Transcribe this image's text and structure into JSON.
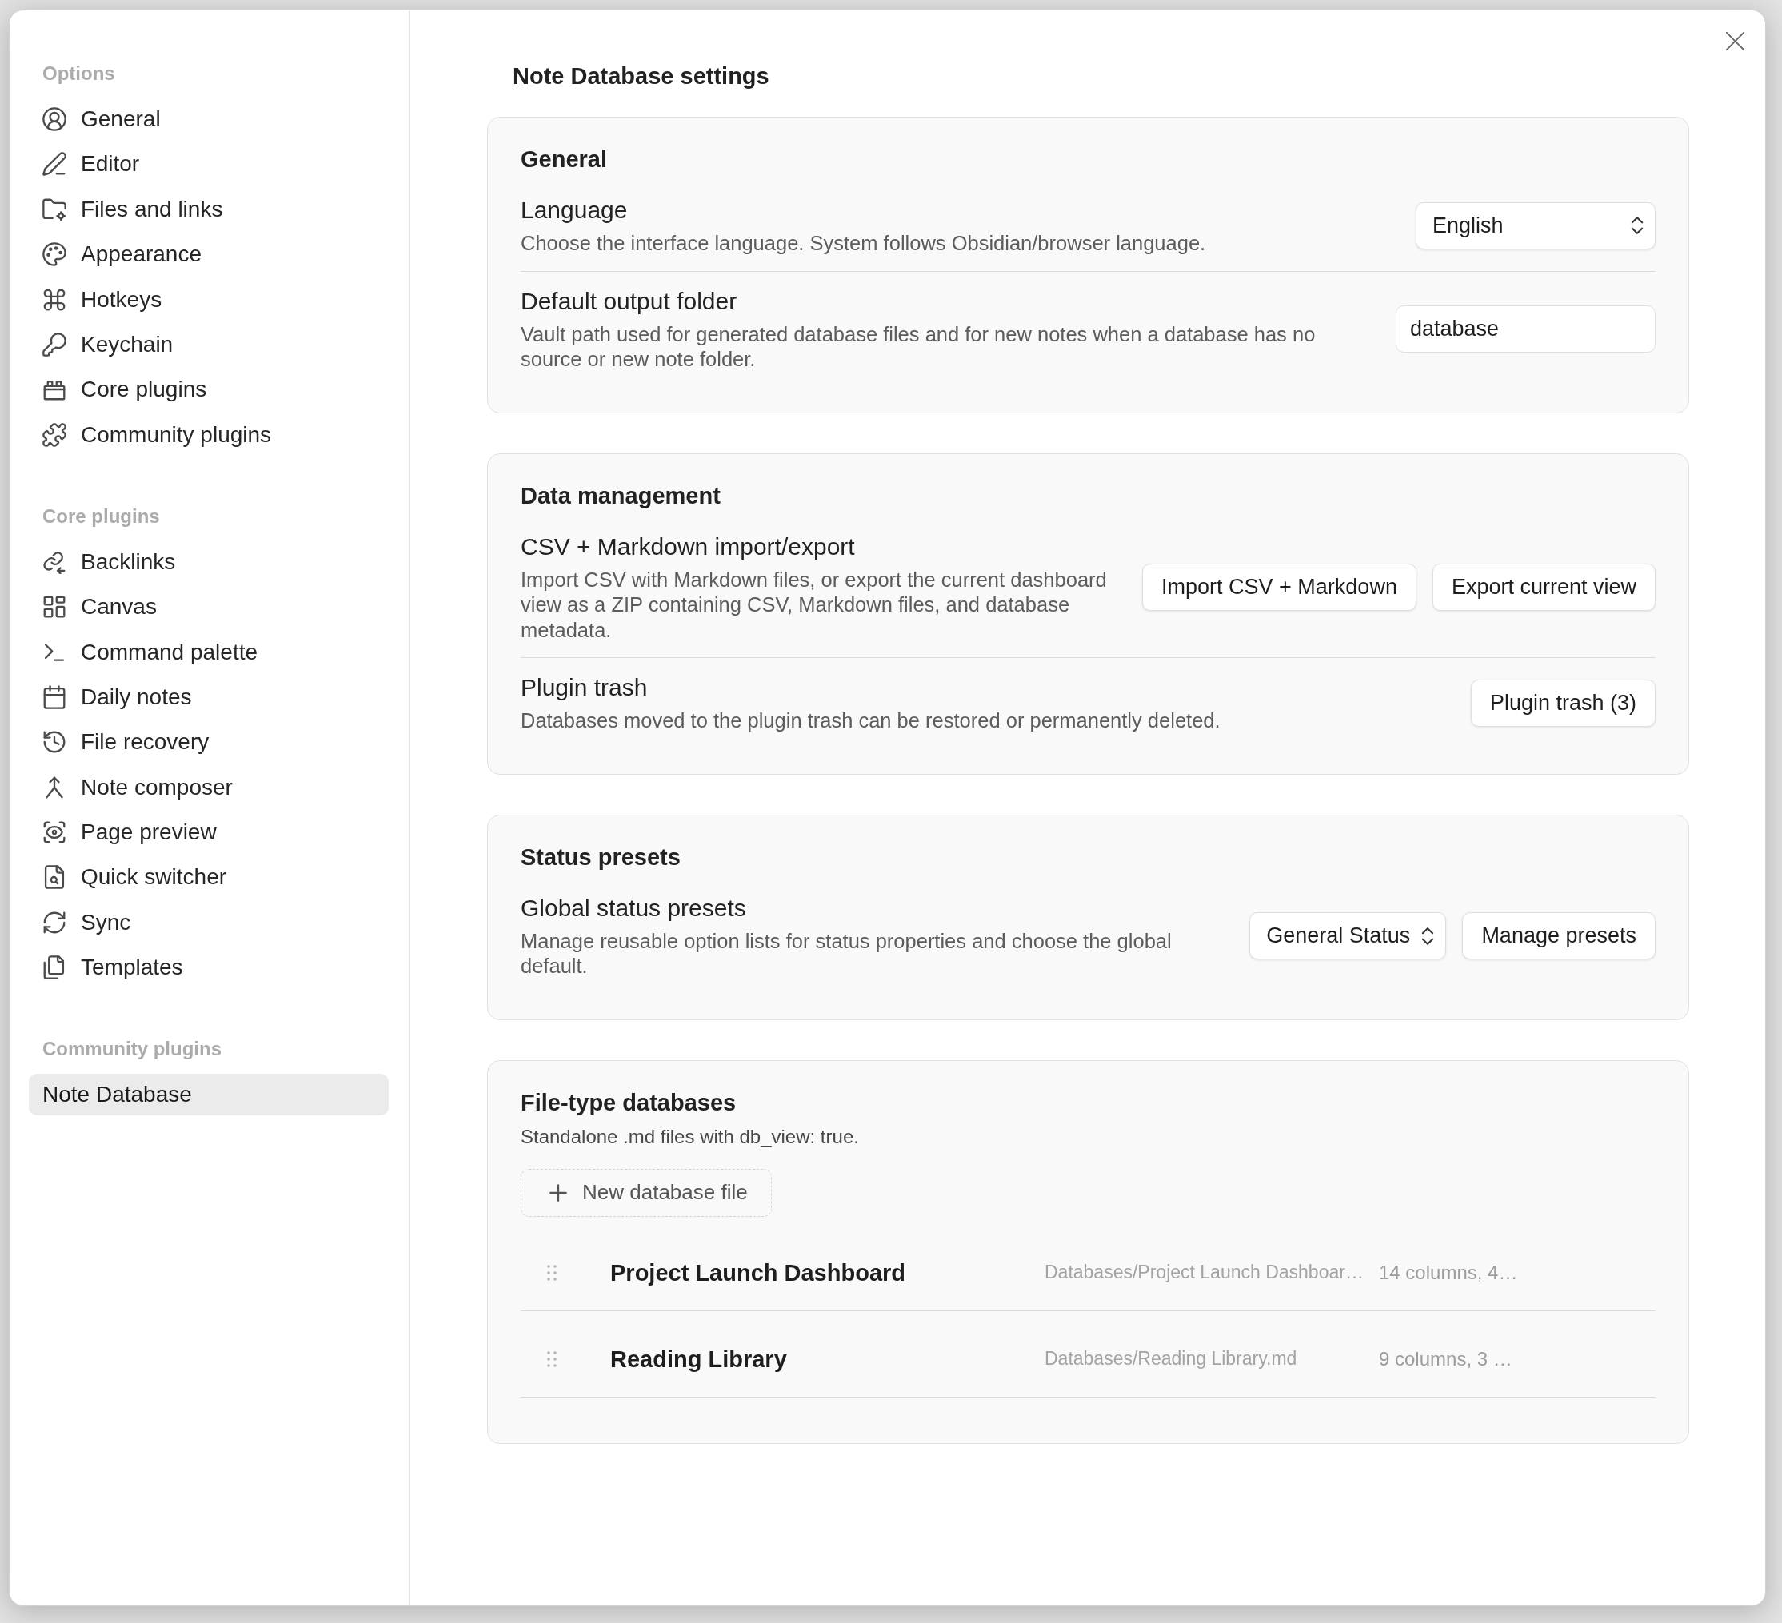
{
  "sidebar": {
    "sections": [
      {
        "heading": "Options",
        "items": [
          {
            "label": "General",
            "selected": false
          },
          {
            "label": "Editor",
            "selected": false
          },
          {
            "label": "Files and links",
            "selected": false
          },
          {
            "label": "Appearance",
            "selected": false
          },
          {
            "label": "Hotkeys",
            "selected": false
          },
          {
            "label": "Keychain",
            "selected": false
          },
          {
            "label": "Core plugins",
            "selected": false
          },
          {
            "label": "Community plugins",
            "selected": false
          }
        ]
      },
      {
        "heading": "Core plugins",
        "items": [
          {
            "label": "Backlinks",
            "selected": false
          },
          {
            "label": "Canvas",
            "selected": false
          },
          {
            "label": "Command palette",
            "selected": false
          },
          {
            "label": "Daily notes",
            "selected": false
          },
          {
            "label": "File recovery",
            "selected": false
          },
          {
            "label": "Note composer",
            "selected": false
          },
          {
            "label": "Page preview",
            "selected": false
          },
          {
            "label": "Quick switcher",
            "selected": false
          },
          {
            "label": "Sync",
            "selected": false
          },
          {
            "label": "Templates",
            "selected": false
          }
        ]
      },
      {
        "heading": "Community plugins",
        "items": [
          {
            "label": "Note Database",
            "selected": true
          }
        ]
      }
    ]
  },
  "page_title": "Note Database settings",
  "cards": [
    {
      "heading": "General",
      "settings": [
        {
          "name": "Language",
          "description": "Choose the interface language. System follows Obsidian/browser language.",
          "controls": [
            {
              "kind": "select",
              "value": "English"
            }
          ]
        },
        {
          "name": "Default output folder",
          "description": "Vault path used for generated database files and for new notes when a database has no source or new note folder.",
          "controls": [
            {
              "kind": "text_input",
              "value": "database"
            }
          ]
        }
      ]
    },
    {
      "heading": "Data management",
      "settings": [
        {
          "name": "CSV + Markdown import/export",
          "description": "Import CSV with Markdown files, or export the current dashboard view as a ZIP containing CSV, Markdown files, and database metadata.",
          "controls": [
            {
              "kind": "button",
              "label": "Import CSV + Markdown"
            },
            {
              "kind": "button",
              "label": "Export current view"
            }
          ]
        },
        {
          "name": "Plugin trash",
          "description": "Databases moved to the plugin trash can be restored or permanently deleted.",
          "controls": [
            {
              "kind": "button",
              "label": "Plugin trash (3)"
            }
          ]
        }
      ]
    },
    {
      "heading": "Status presets",
      "settings": [
        {
          "name": "Global status presets",
          "description": "Manage reusable option lists for status properties and choose the global default.",
          "controls": [
            {
              "kind": "select",
              "value": "General Status"
            },
            {
              "kind": "button",
              "label": "Manage presets"
            }
          ]
        }
      ]
    },
    {
      "heading": "File-type databases",
      "description": "Standalone .md files with db_view: true.",
      "new_button": {
        "label": "New database file"
      },
      "databases": [
        {
          "name": "Project Launch Dashboard",
          "path": "Databases/Project Launch Dashboar…",
          "summary": "14 columns, 4…"
        },
        {
          "name": "Reading Library",
          "path": "Databases/Reading Library.md",
          "summary": "9 columns, 3 …"
        }
      ]
    }
  ]
}
